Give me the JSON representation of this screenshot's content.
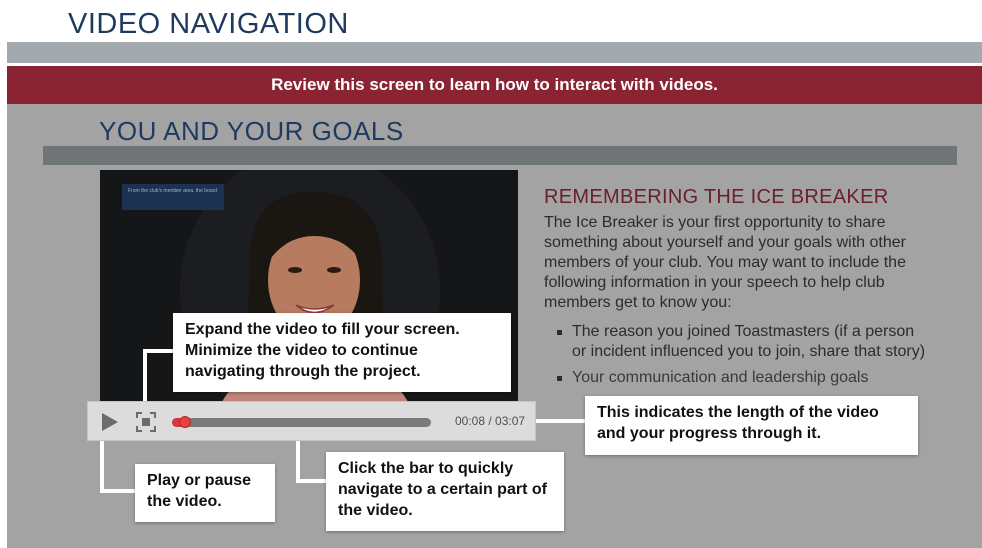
{
  "header": {
    "title": "VIDEO NAVIGATION"
  },
  "banner": {
    "text": "Review this screen to learn how to interact with videos."
  },
  "section": {
    "title": "YOU AND YOUR GOALS"
  },
  "video": {
    "caption_text": "From the club's member area, the board"
  },
  "article": {
    "title": "REMEMBERING THE ICE BREAKER",
    "body": "The Ice Breaker is your first opportunity to share something about yourself and your goals with other members of your club. You may want to include the following information in your speech to help club members get to know you:",
    "bullets": [
      "The reason you joined Toastmasters (if a person or incident influenced you to join, share that story)",
      "Your communication and leadership goals"
    ]
  },
  "player": {
    "time_readout": "00:08 / 03:07",
    "progress_fraction": 0.043,
    "play_icon": "play-icon",
    "expand_icon": "expand-icon"
  },
  "callouts": {
    "expand": "Expand the video to fill your screen. Minimize the video to continue navigating through the project.",
    "length": "This indicates the length of the video and your progress through it.",
    "play": "Play or pause the video.",
    "seek": "Click the bar to quickly navigate to a certain part of the video."
  },
  "colors": {
    "banner": "#8a2432",
    "title_blue": "#1f3a5f",
    "article_title": "#6b1f2a",
    "progress": "#d7363a"
  }
}
